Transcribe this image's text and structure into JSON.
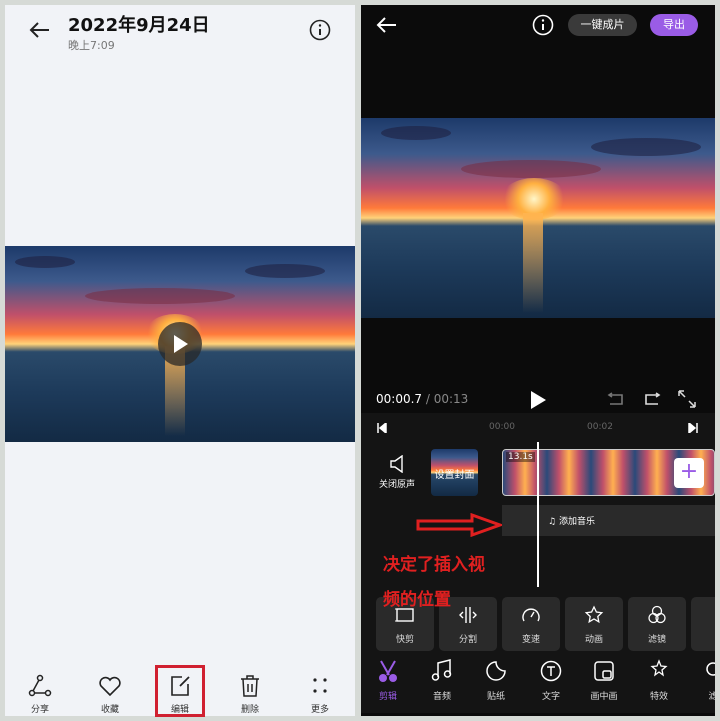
{
  "gallery": {
    "title": "2022年9月24日",
    "subtitle": "晚上7:09",
    "actions": [
      {
        "label": "分享",
        "icon": "share-icon"
      },
      {
        "label": "收藏",
        "icon": "heart-icon"
      },
      {
        "label": "编辑",
        "icon": "edit-icon"
      },
      {
        "label": "删除",
        "icon": "trash-icon"
      },
      {
        "label": "更多",
        "icon": "more-icon"
      }
    ]
  },
  "editor": {
    "one_click": "一键成片",
    "export": "导出",
    "current_time": "00:00.7",
    "total_time": "/ 00:13",
    "ruler": [
      "00:00",
      "00:02"
    ],
    "mute_label": "关闭原声",
    "cover_label": "设置封面",
    "clip_duration": "13.1s",
    "add_music": "添加音乐",
    "tools": [
      "快剪",
      "分割",
      "变速",
      "动画",
      "滤镜"
    ],
    "nav": [
      "剪辑",
      "音频",
      "贴纸",
      "文字",
      "画中画",
      "特效",
      "滤"
    ],
    "accent": "#9a5ce6"
  },
  "annotation": {
    "line1": "决定了插入视",
    "line2": "频的位置",
    "color": "#e02020"
  }
}
